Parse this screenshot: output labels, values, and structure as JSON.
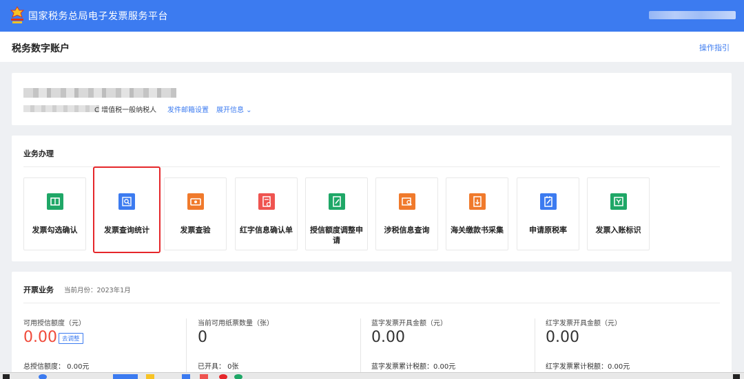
{
  "colors": {
    "topbar": "#3c7bf0",
    "accent": "#3c7bf0",
    "highlight_border": "#e5262a",
    "amount_red": "#f04a3a"
  },
  "header": {
    "app_title": "国家税务总局电子发票服务平台"
  },
  "subheader": {
    "page_title": "税务数字账户",
    "guide_link": "操作指引"
  },
  "account": {
    "taxpayer_type": "C 增值税一般纳税人",
    "mail_settings_link": "发件邮箱设置",
    "expand_link": "展开信息 ⌄"
  },
  "business": {
    "title": "业务办理",
    "tiles": [
      {
        "label": "发票勾选确认",
        "icon": "invoice-check-icon",
        "color": "#1fa767"
      },
      {
        "label": "发票查询统计",
        "icon": "invoice-search-icon",
        "color": "#3c7bf0"
      },
      {
        "label": "发票查验",
        "icon": "invoice-verify-icon",
        "color": "#f07a2c"
      },
      {
        "label": "红字信息确认单",
        "icon": "red-letter-confirm-icon",
        "color": "#ef5450"
      },
      {
        "label": "授信额度调整申请",
        "icon": "credit-adjust-icon",
        "color": "#1fa767"
      },
      {
        "label": "涉税信息查询",
        "icon": "tax-info-search-icon",
        "color": "#f07a2c"
      },
      {
        "label": "海关缴款书采集",
        "icon": "customs-collect-icon",
        "color": "#f07a2c"
      },
      {
        "label": "申请原税率",
        "icon": "original-rate-icon",
        "color": "#3c7bf0"
      },
      {
        "label": "发票入账标识",
        "icon": "invoice-book-icon",
        "color": "#1fa767"
      }
    ]
  },
  "invoicing": {
    "title": "开票业务",
    "month": "当前月份：2023年1月",
    "stats": [
      {
        "label": "可用授信额度（元）",
        "value": "0.00",
        "sub": "总授信额度：  0.00元",
        "action": "去调整"
      },
      {
        "label": "当前可用纸票数量（张）",
        "value": "0",
        "sub": "已开具：  0张"
      },
      {
        "label": "蓝字发票开具金额（元）",
        "value": "0.00",
        "sub": "蓝字发票累计税额：0.00元"
      },
      {
        "label": "红字发票开具金额（元）",
        "value": "0.00",
        "sub": "红字发票累计税额：0.00元"
      }
    ]
  }
}
